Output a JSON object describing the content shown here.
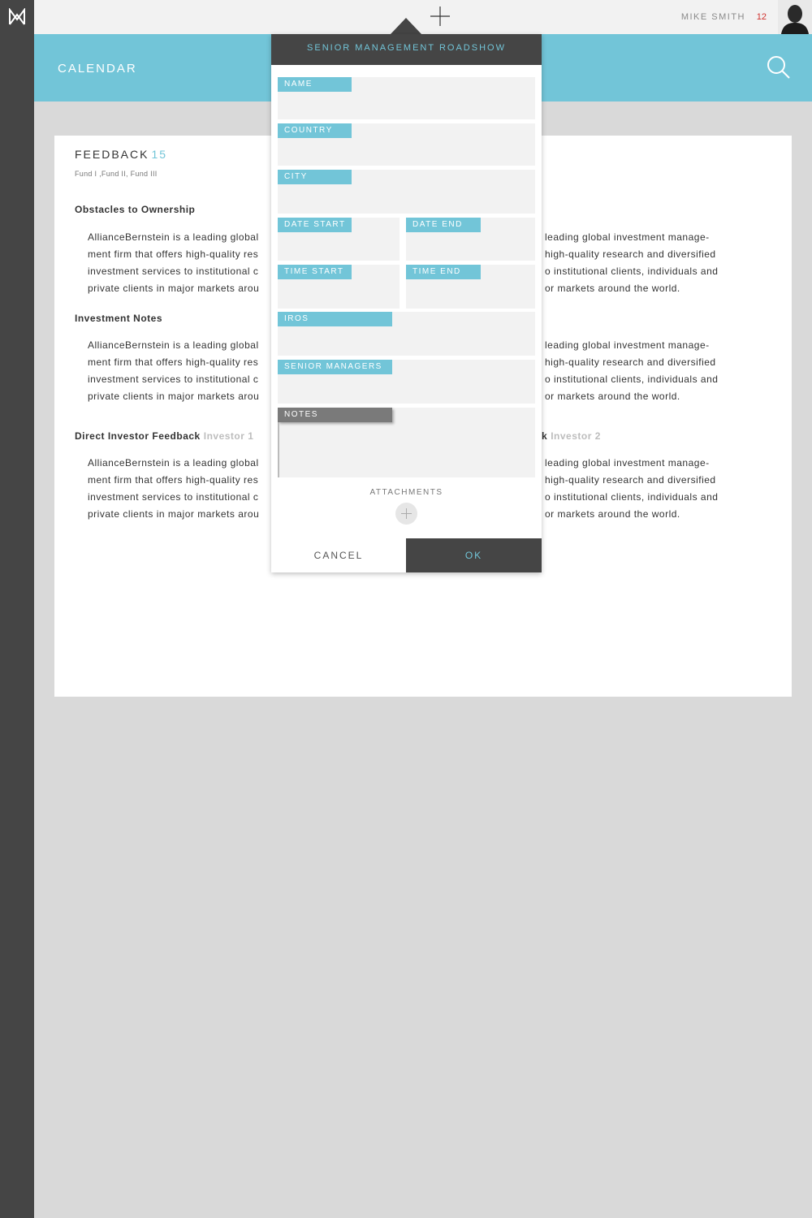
{
  "app": {
    "logo": "M-logo-icon",
    "user_name": "MIKE SMITH",
    "notification_count": "12",
    "add_icon": "plus-icon"
  },
  "header": {
    "title": "CALENDAR",
    "search_icon": "search-icon"
  },
  "feedback": {
    "title": "FEEDBACK",
    "count": "15",
    "funds": "Fund I ,Fund II, Fund III",
    "sections": [
      {
        "title": "Obstacles to Ownership",
        "left_lines": [
          "AllianceBernstein is a leading global",
          "ment firm that offers high-quality res",
          "investment services to institutional c",
          "private clients in major markets arou"
        ],
        "right_lines": [
          "leading global investment manage-",
          "high-quality research and diversified",
          "o institutional clients, individuals and",
          "or markets around the world."
        ]
      },
      {
        "title": "Investment Notes",
        "left_lines": [
          "AllianceBernstein is a leading global",
          "ment firm that offers high-quality res",
          "investment services to institutional c",
          "private clients in major markets arou"
        ],
        "right_lines": [
          "leading global investment manage-",
          "high-quality research and diversified",
          "o institutional clients, individuals and",
          "or markets around the world."
        ]
      },
      {
        "title": "Direct Investor Feedback",
        "subtitle": "Investor 1",
        "right_title_fragment": "k",
        "right_subtitle": "Investor 2",
        "left_lines": [
          "AllianceBernstein is a leading global",
          "ment firm that offers high-quality res",
          "investment services to institutional c",
          "private clients in major markets arou"
        ],
        "right_lines": [
          "leading global investment manage-",
          "high-quality research and diversified",
          "o institutional clients, individuals and",
          "or markets around the world."
        ]
      }
    ]
  },
  "popup": {
    "title": "SENIOR MANAGEMENT ROADSHOW",
    "fields": {
      "name": "NAME",
      "country": "COUNTRY",
      "city": "CITY",
      "date_start": "DATE START",
      "date_end": "DATE END",
      "time_start": "TIME START",
      "time_end": "TIME END",
      "iros": "IROS",
      "senior_managers": "SENIOR MANAGERS",
      "notes": "NOTES"
    },
    "attachments_label": "ATTACHMENTS",
    "cancel_label": "CANCEL",
    "ok_label": "OK"
  },
  "colors": {
    "accent": "#72c5d8",
    "dark": "#454545",
    "background": "#d9d9d9",
    "notification": "#d0312d"
  }
}
